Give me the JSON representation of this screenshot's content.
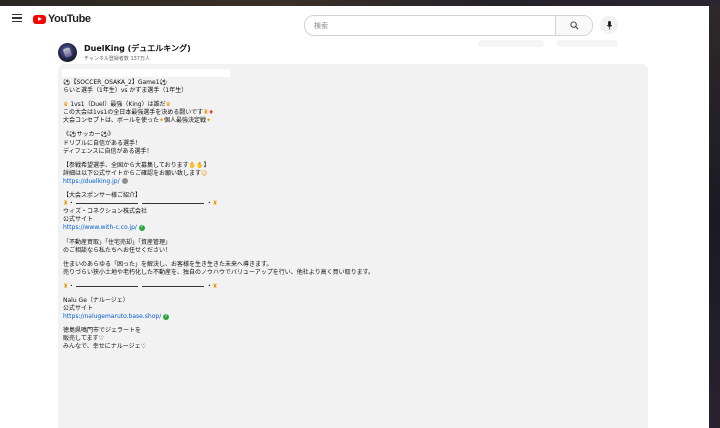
{
  "app": {
    "logo_text": "YouTube"
  },
  "search": {
    "placeholder": "検索"
  },
  "channel": {
    "name": "DuelKing (デュエルキング)",
    "subscribers": "チャンネル登録者数 137万人"
  },
  "description": {
    "title_line": "【SOCCER_OSAKA_2】Game1",
    "players": "らいと選手（1年生）vs かずま選手（1年生）",
    "king_line": "1vs1（Duel）最強（King）は誰だ",
    "intro_1": "この大会は1vs1の全日本最強選手を決める闘いです",
    "intro_2a": "大会コンセプトは、ボールを使った",
    "intro_2b": "個人最強決定戦",
    "soccer_heading": "サッカー",
    "dribble": "ドリブルに自信がある選手！",
    "defense": "ディフェンスに自信がある選手！",
    "recruit_heading": "【参戦希望選手、全国から大募集しております",
    "details": "詳細は以下公式サイトからご確認をお願い致します",
    "official_url": "https://duelking.jp/",
    "sponsor_heading": "【大会スポンサー様ご紹介】",
    "sponsor1_name": "ウィズ・コネクション株式会社",
    "official_site": "公式サイト",
    "sponsor1_url": "https://www.with-c.co.jp/",
    "realestate_1": "「不動産買取」「住宅売却」「資産管理」",
    "realestate_2": "のご相談なら私たちへお任せください！",
    "realestate_3": "住まいのあらゆる「困った」を解決し、お客様を生き生きた未来へ導きます。",
    "realestate_4": "売りづらい狭小土地や老朽化した不動産を、独自のノウハウでバリューアップを行い、他社より高く買い取ります。",
    "sponsor2_name": "Nalu Ge（ナルージェ）",
    "sponsor2_url": "https://nalugemaruto.base.shop/",
    "gelato_1": "徳島県鳴門市でジェラートを",
    "gelato_2": "販売してます♡",
    "gelato_3": "みんなで、幸せにナルージェ♡"
  },
  "colors": {
    "link": "#065fd4",
    "logo_red": "#ff0000",
    "verified_green": "#2ba640"
  },
  "icons": [
    "menu-icon",
    "youtube-logo-icon",
    "search-icon",
    "mic-icon",
    "soccer-ball-icon",
    "crown-icon",
    "trophy-icon",
    "fire-icon",
    "sparkle-icon",
    "clap-icon",
    "smile-icon",
    "verified-icon"
  ]
}
